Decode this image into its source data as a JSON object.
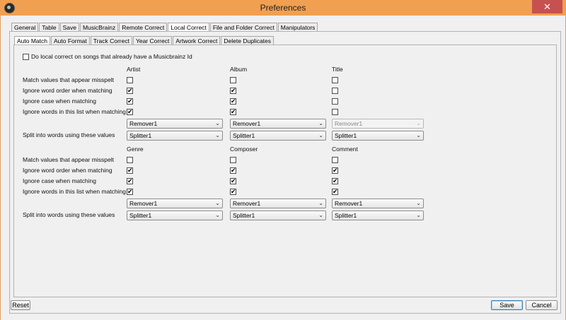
{
  "window": {
    "title": "Preferences",
    "close_glyph": "✕"
  },
  "main_tabs": [
    "General",
    "Table",
    "Save",
    "MusicBrainz",
    "Remote Correct",
    "Local Correct",
    "File and Folder Correct",
    "Manipulators"
  ],
  "main_tab_active": "Local Correct",
  "sub_tabs": [
    "Auto Match",
    "Auto Format",
    "Track Correct",
    "Year Correct",
    "Artwork Correct",
    "Delete Duplicates"
  ],
  "sub_tab_active": "Auto Match",
  "top_option": {
    "label": "Do local correct on songs that already have a Musicbrainz Id",
    "checked": false
  },
  "row_labels": {
    "misspelt": "Match values that appear misspelt",
    "word_order": "Ignore word order when matching",
    "case": "Ignore case when matching",
    "words_list": "Ignore words in this list when matching",
    "split": "Split into words using these values"
  },
  "section1": {
    "columns": [
      "Artist",
      "Album",
      "Title"
    ],
    "misspelt": [
      false,
      false,
      false
    ],
    "word_order": [
      true,
      true,
      false
    ],
    "case": [
      true,
      true,
      false
    ],
    "words_list": [
      true,
      true,
      false
    ],
    "remover": [
      "Remover1",
      "Remover1",
      "Remover1"
    ],
    "remover_enabled": [
      true,
      true,
      false
    ],
    "splitter": [
      "Splitter1",
      "Splitter1",
      "Splitter1"
    ]
  },
  "section2": {
    "columns": [
      "Genre",
      "Composer",
      "Comment"
    ],
    "misspelt": [
      false,
      false,
      false
    ],
    "word_order": [
      true,
      true,
      true
    ],
    "case": [
      true,
      true,
      true
    ],
    "words_list": [
      true,
      true,
      true
    ],
    "remover": [
      "Remover1",
      "Remover1",
      "Remover1"
    ],
    "remover_enabled": [
      true,
      true,
      true
    ],
    "splitter": [
      "Splitter1",
      "Splitter1",
      "Splitter1"
    ]
  },
  "buttons": {
    "reset": "Reset",
    "save": "Save",
    "cancel": "Cancel"
  },
  "colors": {
    "titlebar": "#f0a050",
    "close": "#c75050"
  },
  "icons": {
    "app": "app-icon",
    "close": "close-icon",
    "dropdown": "chevron-down-icon"
  }
}
